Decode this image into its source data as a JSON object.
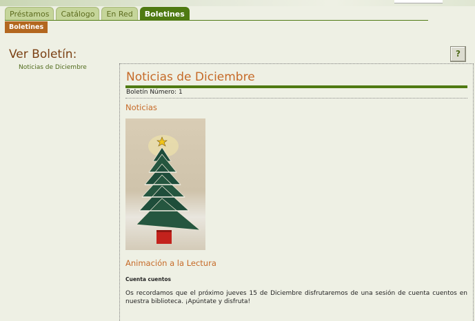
{
  "tabs": [
    {
      "label": "Préstamos",
      "active": false
    },
    {
      "label": "Catálogo",
      "active": false
    },
    {
      "label": "En Red",
      "active": false
    },
    {
      "label": "Boletines",
      "active": true
    }
  ],
  "subtab": {
    "label": "Boletines"
  },
  "sidebar": {
    "title": "Ver Boletín:",
    "link": "Noticias de Diciembre"
  },
  "help_button": {
    "label": "?"
  },
  "bulletin": {
    "title": "Noticias de Diciembre",
    "number": "Boletín Número: 1",
    "section_news": "Noticias",
    "image_icon": "christmas-tree-books-photo",
    "section_activity": "Animación a la Lectura",
    "story_title": "Cuenta cuentos",
    "story_text": "Os recordamos que el próximo jueves 15 de Diciembre disfrutaremos de una sesión de cuenta cuentos en nuestra biblioteca. ¡Apúntate y disfruta!"
  },
  "colors": {
    "accent_green": "#4f7a12",
    "heading_orange": "#c66a28",
    "subtab_orange": "#b3671f",
    "background": "#eef0e4"
  }
}
